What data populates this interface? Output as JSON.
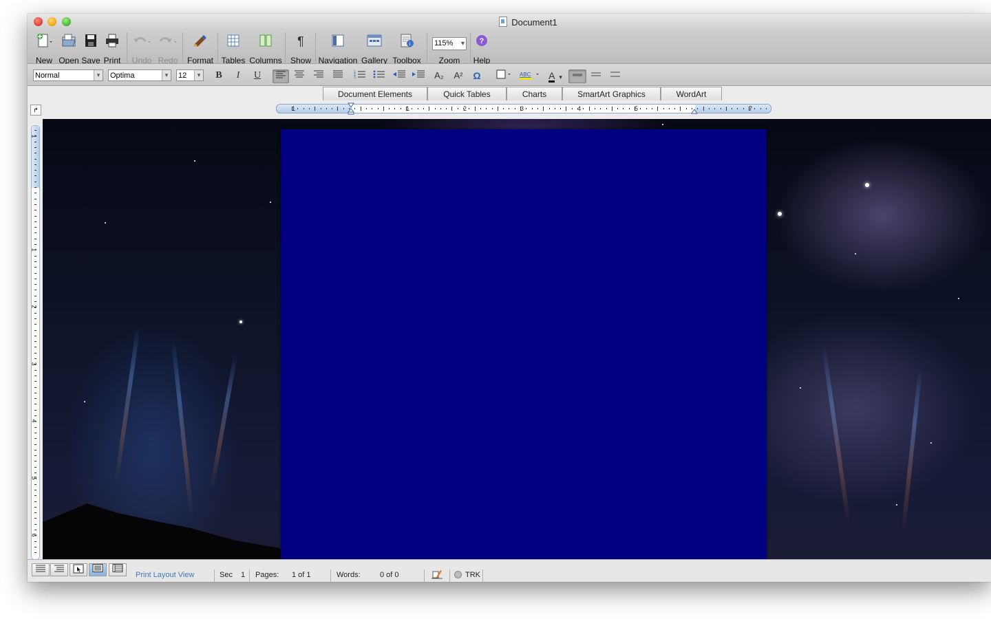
{
  "window": {
    "title": "Document1"
  },
  "toolbar": {
    "new": "New",
    "open": "Open",
    "save": "Save",
    "print": "Print",
    "undo": "Undo",
    "redo": "Redo",
    "format": "Format",
    "tables": "Tables",
    "columns": "Columns",
    "show": "Show",
    "navigation": "Navigation",
    "gallery": "Gallery",
    "toolbox": "Toolbox",
    "zoom_value": "115%",
    "zoom": "Zoom",
    "help": "Help"
  },
  "formatting": {
    "style": "Normal",
    "font": "Optima",
    "size": "12",
    "bold": "B",
    "italic": "I",
    "underline": "U",
    "subscript": "A₂",
    "superscript": "A²",
    "symbol": "Ω",
    "font_color_glyph": "A"
  },
  "gallery_tabs": [
    "Document Elements",
    "Quick Tables",
    "Charts",
    "SmartArt Graphics",
    "WordArt"
  ],
  "ruler": {
    "h_numbers": [
      "1",
      "1",
      "2",
      "3",
      "4",
      "5",
      "7"
    ],
    "v_numbers": [
      "1",
      "1",
      "2",
      "3",
      "4",
      "5",
      "6"
    ]
  },
  "status": {
    "view": "Print Layout View",
    "sec_label": "Sec",
    "sec_value": "1",
    "pages_label": "Pages:",
    "pages_value": "1 of 1",
    "words_label": "Words:",
    "words_value": "0 of 0",
    "trk": "TRK"
  },
  "colors": {
    "page": "#000080",
    "ruler_blue": "#b3cbe8"
  },
  "icons": {
    "new": "new-document-icon",
    "open": "open-folder-icon",
    "save": "floppy-disk-icon",
    "print": "printer-icon",
    "undo": "undo-arrow-icon",
    "redo": "redo-arrow-icon",
    "format": "paintbrush-icon",
    "tables": "table-grid-icon",
    "columns": "columns-icon",
    "show": "pilcrow-icon",
    "navigation": "navigation-pane-icon",
    "gallery": "gallery-icon",
    "toolbox": "toolbox-icon",
    "help": "help-question-icon"
  }
}
